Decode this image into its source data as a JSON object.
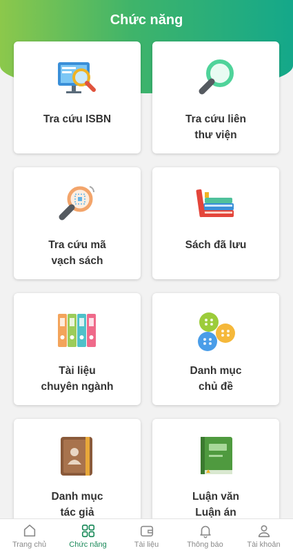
{
  "header": {
    "title": "Chức năng"
  },
  "cards": [
    {
      "line1": "Tra cứu ISBN",
      "line2": "",
      "icon": "isbn-search-icon"
    },
    {
      "line1": "Tra cứu liên",
      "line2": "thư viện",
      "icon": "magnifier-icon"
    },
    {
      "line1": "Tra cứu mã",
      "line2": "vạch sách",
      "icon": "barcode-scan-icon"
    },
    {
      "line1": "Sách đã lưu",
      "line2": "",
      "icon": "books-icon"
    },
    {
      "line1": "Tài liệu",
      "line2": "chuyên ngành",
      "icon": "binders-icon"
    },
    {
      "line1": "Danh mục",
      "line2": "chủ đề",
      "icon": "buttons-icon"
    },
    {
      "line1": "Danh mục",
      "line2": "tác giả",
      "icon": "author-book-icon"
    },
    {
      "line1": "Luận văn",
      "line2": "Luận án",
      "icon": "thesis-book-icon"
    }
  ],
  "tabbar": {
    "active_color": "#1b8a5a",
    "items": [
      {
        "label": "Trang chủ",
        "icon": "home-icon"
      },
      {
        "label": "Chức năng",
        "icon": "grid-icon"
      },
      {
        "label": "Tài liệu",
        "icon": "wallet-icon"
      },
      {
        "label": "Thông báo",
        "icon": "bell-icon"
      },
      {
        "label": "Tài khoản",
        "icon": "user-icon"
      }
    ]
  }
}
